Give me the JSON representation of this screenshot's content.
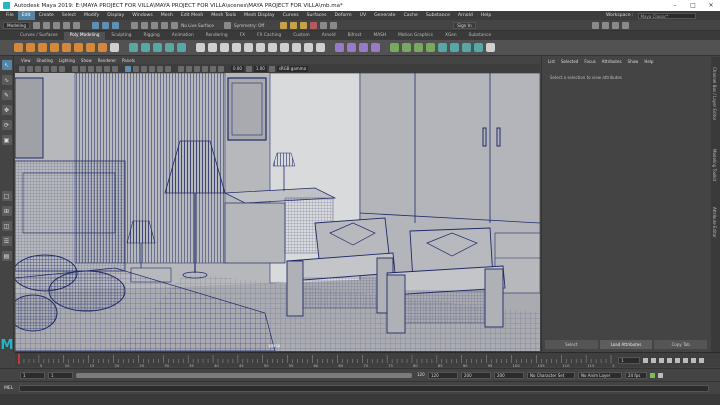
{
  "window": {
    "title": "Autodesk Maya 2019: E:\\MAYA PROJECT FOR VILLA\\MAYA PROJECT FOR VILLA\\scenes\\MAYA PROJECT FOR VILLA\\mb.ma*",
    "minimize": "–",
    "maximize": "□",
    "close": "✕"
  },
  "menubar": {
    "items": [
      "File",
      "Edit",
      "Create",
      "Select",
      "Modify",
      "Display",
      "Windows",
      "Mesh",
      "Edit Mesh",
      "Mesh Tools",
      "Mesh Display",
      "Curves",
      "Surfaces",
      "Deform",
      "UV",
      "Generate",
      "Cache",
      "Substance",
      "Arnold",
      "Help"
    ],
    "active_index": 1,
    "workspace_label": "Workspace :",
    "workspace_value": "Maya Classic*"
  },
  "statusline": {
    "menuset": "Modeling",
    "no_live_surface": "No Live Surface",
    "symmetry": "Symmetry: Off",
    "sign_in": "Sign In"
  },
  "shelf_tabs": [
    "Curves / Surfaces",
    "Poly Modeling",
    "Sculpting",
    "Rigging",
    "Animation",
    "Rendering",
    "FX",
    "FX Caching",
    "Custom",
    "Arnold",
    "Bifrost",
    "MASH",
    "Motion Graphics",
    "XGen",
    "Substance"
  ],
  "shelf_active": 1,
  "viewport": {
    "menu": [
      "View",
      "Shading",
      "Lighting",
      "Show",
      "Renderer",
      "Panels"
    ],
    "near_clip": "0.00",
    "scale": "1.00",
    "color_space": "sRGB gamma",
    "camera": "persp"
  },
  "channelbox": {
    "tabs": [
      "List",
      "Selected",
      "Focus",
      "Attributes",
      "Show",
      "Help"
    ],
    "message": "Select a selection to view attributes",
    "buttons": [
      "Select",
      "Load Attributes",
      "Copy Tab"
    ]
  },
  "side_tabs": [
    "Channel Box / Layer Editor",
    "Modeling Toolkit",
    "Attribute Editor"
  ],
  "timeslider": {
    "ticks": [
      "5",
      "10",
      "15",
      "20",
      "25",
      "30",
      "35",
      "40",
      "45",
      "50",
      "55",
      "60",
      "65",
      "70",
      "75",
      "80",
      "85",
      "90",
      "95",
      "100",
      "105",
      "110",
      "115",
      "120"
    ],
    "current_frame": "1"
  },
  "rangebar": {
    "start": "1",
    "playback_start": "1",
    "range_label": "120",
    "end": "120",
    "playback_end": "200",
    "anim_end": "200",
    "character_set": "No Character Set",
    "anim_layer": "No Anim Layer",
    "fps": "24 fps"
  },
  "cmdline": {
    "language": "MEL"
  },
  "colors": {
    "accent": "#5285a6",
    "viewport_bg": "#b6b6b9",
    "wire": "#1f2a66",
    "maya_logo": "#28b4c8"
  }
}
